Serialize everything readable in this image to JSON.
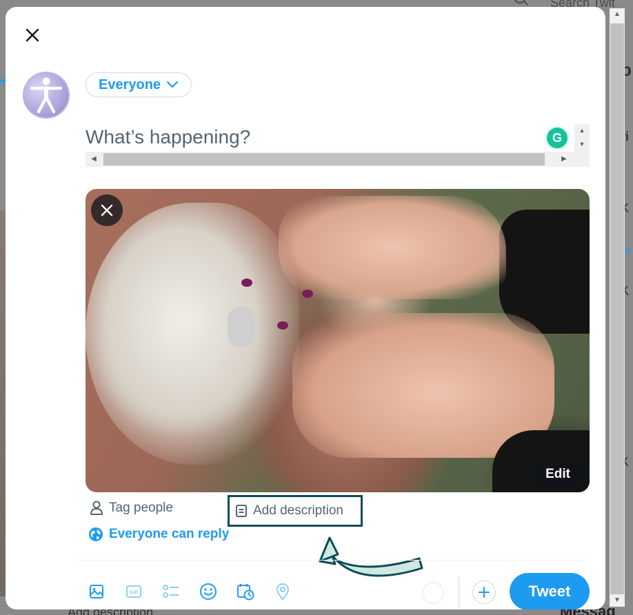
{
  "background": {
    "search_label": "Search Twit",
    "bottom_text": "Add description",
    "bottom_right_text": "Messag",
    "right_fragments": [
      "p",
      "ri",
      "K",
      "er",
      "K",
      "K"
    ]
  },
  "modal": {
    "close_icon": "close-icon",
    "audience": {
      "label": "Everyone",
      "icon": "chevron-down-icon"
    },
    "compose": {
      "placeholder": "What’s happening?"
    },
    "grammarly_icon": "grammarly-icon",
    "media": {
      "alt": "Photo of hands adjusting a hearing aid behind an older man's ear",
      "edit_label": "Edit"
    },
    "media_actions": {
      "tag_people": "Tag people",
      "add_description": "Add description"
    },
    "reply_setting": "Everyone can reply",
    "toolbar": {
      "items": [
        {
          "name": "media-icon"
        },
        {
          "name": "gif-icon"
        },
        {
          "name": "poll-icon"
        },
        {
          "name": "emoji-icon"
        },
        {
          "name": "schedule-icon"
        },
        {
          "name": "location-icon"
        }
      ],
      "tweet_label": "Tweet"
    },
    "colors": {
      "accent": "#1d9bf0",
      "annotation": "#0e4a59",
      "arrow_fill": "#cfe9e2"
    }
  }
}
